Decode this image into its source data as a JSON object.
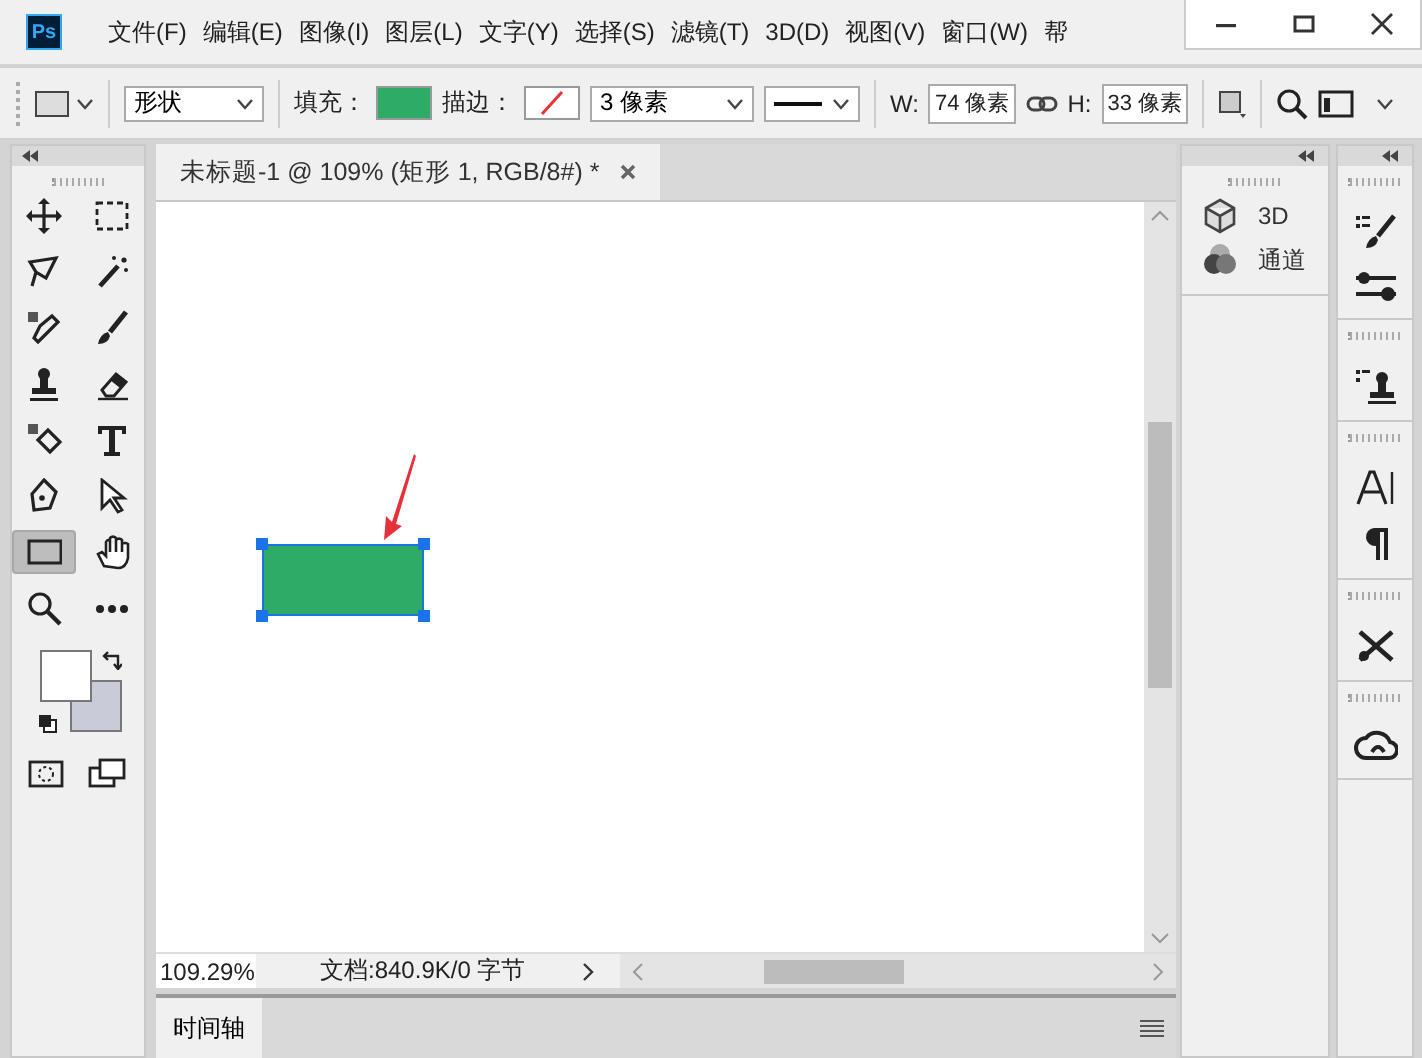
{
  "app_logo": "Ps",
  "menu": [
    "文件(F)",
    "编辑(E)",
    "图像(I)",
    "图层(L)",
    "文字(Y)",
    "选择(S)",
    "滤镜(T)",
    "3D(D)",
    "视图(V)",
    "窗口(W)",
    "帮"
  ],
  "options_bar": {
    "shape_mode": "形状",
    "fill_label": "填充：",
    "stroke_label": "描边：",
    "stroke_width": "3 像素",
    "width_label": "W:",
    "width_value": "74 像素",
    "height_label": "H:",
    "height_value": "33 像素"
  },
  "document_tab": {
    "title": "未标题-1 @ 109% (矩形 1, RGB/8#) *"
  },
  "tools": [
    {
      "selected": false
    },
    {
      "selected": false
    },
    {
      "selected": false
    },
    {
      "selected": false
    },
    {
      "selected": false
    },
    {
      "selected": false
    },
    {
      "selected": false
    },
    {
      "selected": false
    },
    {
      "selected": false
    },
    {
      "selected": false
    },
    {
      "selected": false
    },
    {
      "selected": false
    },
    {
      "selected": true
    },
    {
      "selected": false
    },
    {
      "selected": false
    },
    {
      "selected": false
    }
  ],
  "status_bar": {
    "zoom": "109.29%",
    "doc_info": "文档:840.9K/0 字节"
  },
  "bottom_panel": {
    "tab": "时间轴"
  },
  "right_panel": {
    "items": [
      "3D",
      "通道"
    ]
  }
}
